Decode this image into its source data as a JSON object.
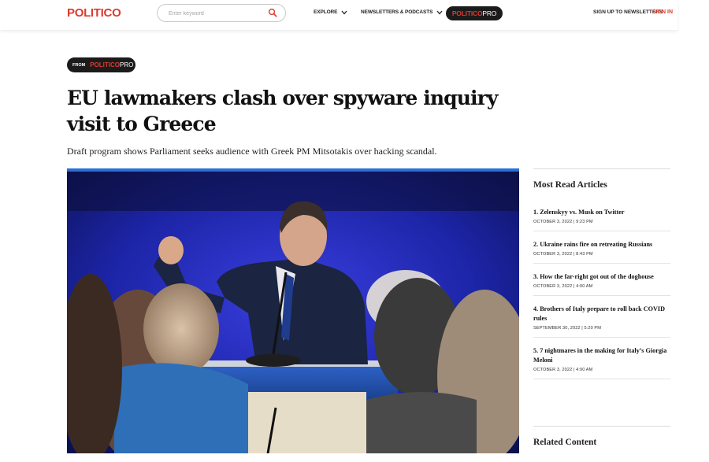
{
  "header": {
    "logo": "POLITICO",
    "search_placeholder": "Enter keyword",
    "explore": "EXPLORE",
    "newsletters": "NEWSLETTERS & PODCASTS",
    "pro_part1": "POLITICO",
    "pro_part2": "PRO",
    "signup": "SIGN UP TO NEWSLETTERS",
    "signin": "SIGN IN"
  },
  "article": {
    "from_label": "FROM",
    "from_part1": "POLITICO",
    "from_part2": "PRO",
    "headline": "EU lawmakers clash over spyware inquiry visit to Greece",
    "dek": "Draft program shows Parliament seeks audience with Greek PM Mitsotakis over hacking scandal."
  },
  "sidebar": {
    "most_read_title": "Most Read Articles",
    "items": [
      {
        "title": "1. Zelenskyy vs. Musk on Twitter",
        "date": "OCTOBER 3, 2022 | 9:23 PM"
      },
      {
        "title": "2. Ukraine rains fire on retreating Russians",
        "date": "OCTOBER 3, 2022 | 8:43 PM"
      },
      {
        "title": "3. How the far-right got out of the doghouse",
        "date": "OCTOBER 3, 2022 | 4:00 AM"
      },
      {
        "title": "4. Brothers of Italy prepare to roll back COVID rules",
        "date": "SEPTEMBER 30, 2022 | 5:20 PM"
      },
      {
        "title": "5. 7 nightmares in the making for Italy’s Giorgia Meloni",
        "date": "OCTOBER 3, 2022 | 4:00 AM"
      }
    ],
    "related_title": "Related Content"
  },
  "colors": {
    "brand_red": "#dc3a2e",
    "dark_pill": "#1b1b1b"
  }
}
